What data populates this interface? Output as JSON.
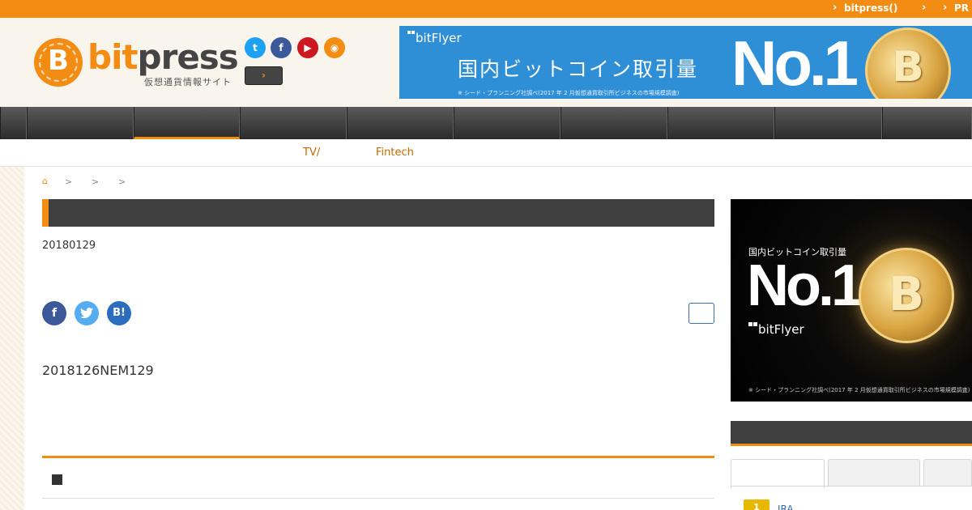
{
  "topbar": {
    "links": [
      {
        "label": "bitpress()"
      },
      {
        "label": ""
      },
      {
        "label": "PR"
      }
    ]
  },
  "header": {
    "logo": {
      "coin_letter": "B",
      "name_part1": "bit",
      "name_part2": "press",
      "tagline": "仮想通貨情報サイト"
    },
    "social": [
      "twitter-icon",
      "facebook-icon",
      "youtube-icon",
      "rss-icon"
    ],
    "arrow_button": "›",
    "banner": {
      "brand": "bitFlyer",
      "headline": "国内ビットコイン取引量",
      "big": "No.1",
      "note": "※ シード・プランニング社調べ(2017 年 2 月仮想通貨取引所ビジネスの市場規模調査)"
    }
  },
  "nav": {
    "items": [
      "",
      "",
      "",
      "",
      "",
      "",
      "",
      "",
      "",
      ""
    ],
    "active_index": 1
  },
  "subnav": {
    "links": [
      "TV/",
      "Fintech"
    ]
  },
  "breadcrumb": {
    "separators": [
      ">",
      ">",
      ">"
    ]
  },
  "article": {
    "date": "20180129",
    "body": "2018126NEM129",
    "share": {
      "facebook": "f",
      "twitter": "t",
      "hatena": "B!"
    }
  },
  "sidebar": {
    "ad": {
      "headline": "国内ビットコイン取引量",
      "big": "No.1",
      "brand": "bitFlyer",
      "note": "※ シード・プランニング社調べ(2017 年 2 月仮想通貨取引所ビジネスの市場規模調査)"
    },
    "ranking": {
      "badge": "1",
      "first_item": "IRA"
    }
  },
  "colors": {
    "accent": "#f28c12",
    "dark": "#3f3f3f",
    "banner_blue": "#2f8fd6"
  }
}
